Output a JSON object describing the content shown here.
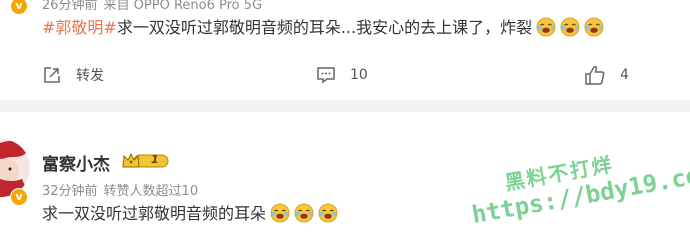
{
  "post1": {
    "meta_time": "26分钟前",
    "meta_source": "来自 OPPO Reno6 Pro 5G",
    "verified_badge": "v",
    "hashtag": "#郭敬明#",
    "text": "求一双没听过郭敬明音频的耳朵...我安心的去上课了，炸裂",
    "emoji_icon": "laugh-cry-emoji",
    "actions": {
      "share_label": "转发",
      "comment_count": "10",
      "like_count": "4"
    }
  },
  "post2": {
    "username": "富察小杰",
    "level_badge": "1",
    "verified_badge": "v",
    "meta_time": "32分钟前",
    "meta_note": "转赞人数超过10",
    "text": "求一双没听过郭敬明音频的耳朵"
  },
  "watermark": {
    "line1": "黑料不打烊",
    "line2": "https://bdy19.co"
  },
  "colors": {
    "hashtag": "#eb7350",
    "meta": "#8c8c8c",
    "badge": "#f7a600",
    "watermark": "#4fc36e",
    "divider": "#f2f2f2"
  }
}
